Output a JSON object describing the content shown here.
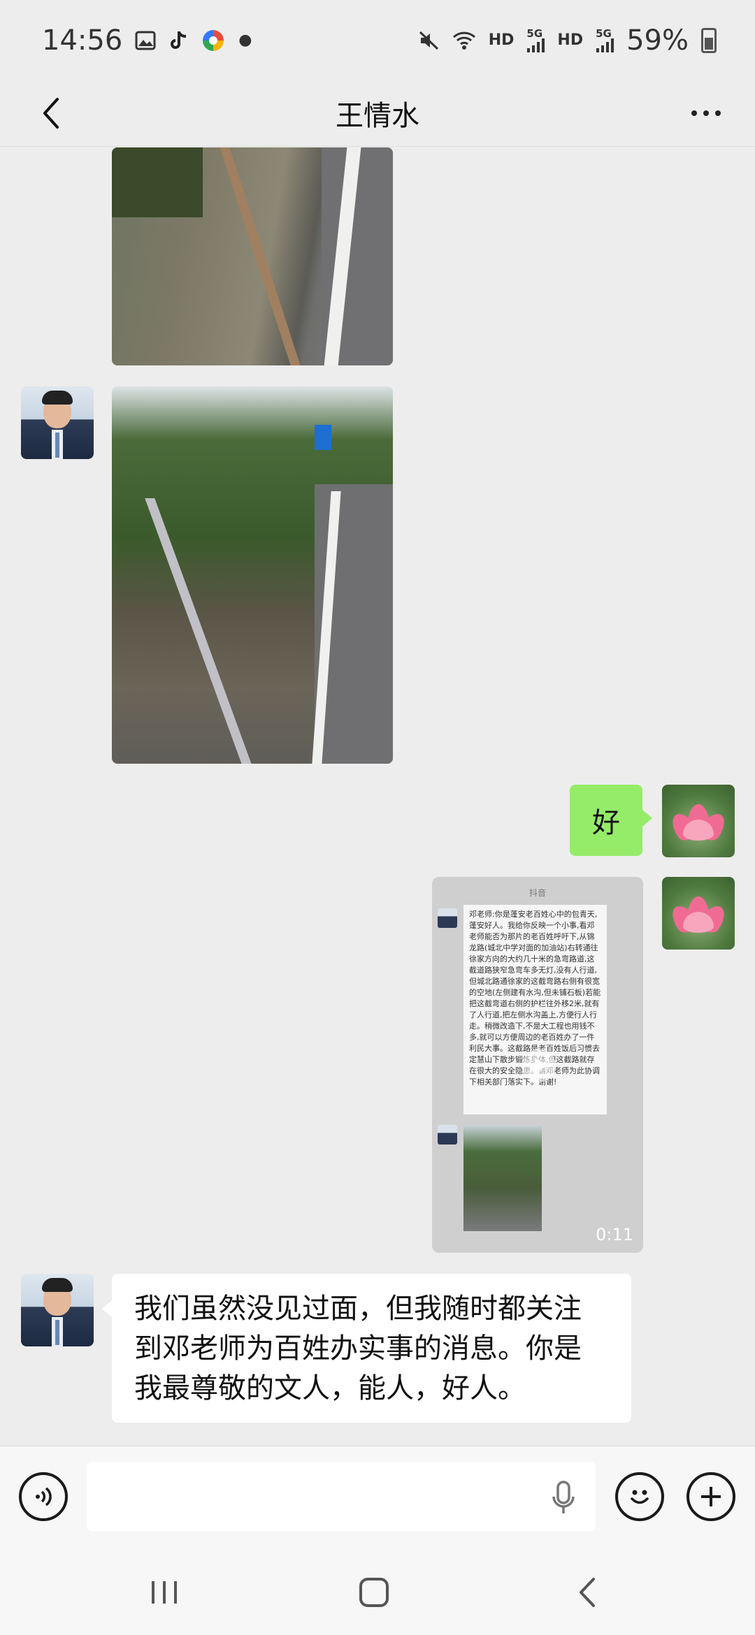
{
  "status_bar": {
    "time": "14:56",
    "network_a": "HD",
    "signal_a": "5G",
    "network_b": "HD",
    "signal_b": "5G",
    "battery": "59%"
  },
  "header": {
    "title": "王情水"
  },
  "messages": {
    "reply_text": "好",
    "video": {
      "duration": "0:11",
      "header_text": "抖音",
      "preview_text": "邓老师:你是蓬安老百姓心中的包青天,蓬安好人。我给你反映一个小事,看邓老师能否为那片的老百姓呼吁下,从锦龙路(城北中学对面的加油站)右转通往徐家方向的大约几十米的急弯路道,这截道路狭窄急弯车多无灯,没有人行道,但城北路通徐家的这截弯路右侧有很宽的空地(左侧建有水沟,但未铺石板)若能把这截弯道右侧的护栏往外移2米,就有了人行道,把左侧水沟盖上,方便行人行走。稍微改造下,不是大工程也用钱不多,就可以方便周边的老百姓办了一件利民大事。这截路是老百姓饭后习惯去定慧山下散步锻炼身体,但这截路就存在很大的安全隐患。请邓老师为此协调下相关部门落实下。谢谢!"
    },
    "incoming_text": "我们虽然没见过面，但我随时都关注到邓老师为百姓办实事的消息。你是我最尊敬的文人，能人，好人。"
  },
  "input_bar": {
    "value": "",
    "placeholder": ""
  },
  "colors": {
    "outgoing_bubble": "#95ec69",
    "incoming_bubble": "#ffffff",
    "background": "#ededed"
  },
  "icons": [
    "picture-icon",
    "tiktok-icon",
    "app-icon",
    "mute-icon",
    "wifi-icon",
    "signal-icon",
    "battery-icon",
    "back-icon",
    "more-icon",
    "voice-icon",
    "microphone-icon",
    "emoji-icon",
    "plus-icon",
    "play-icon",
    "recent-apps-icon",
    "home-icon",
    "system-back-icon"
  ]
}
